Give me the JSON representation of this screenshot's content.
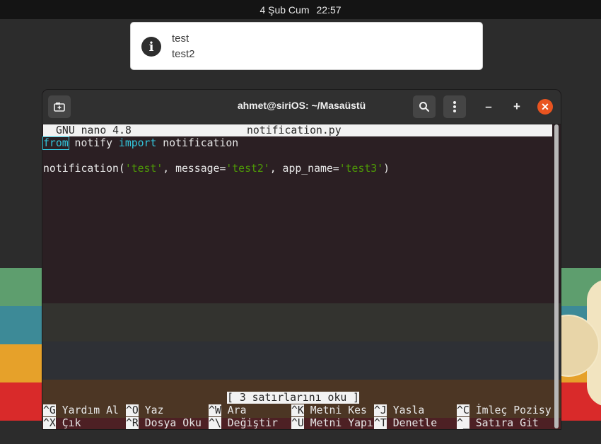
{
  "topbar": {
    "date": "4 Şub Cum",
    "time": "22:57"
  },
  "notification": {
    "icon": "info-icon",
    "title": "test",
    "body": "test2"
  },
  "terminal": {
    "title": "ahmet@siriOS: ~/Masaüstü",
    "buttons": {
      "new_tab": "new-tab-icon",
      "search": "search-icon",
      "menu": "menu-icon",
      "minimize": "–",
      "maximize": "+",
      "close": "✕"
    },
    "nano": {
      "version": "GNU nano 4.8",
      "filename": "notification.py",
      "code": {
        "line1": {
          "kw_from": "from",
          "module": " notify ",
          "kw_import": "import",
          "name": " notification"
        },
        "line3": {
          "call_open": "notification(",
          "arg1": "'test'",
          "mid1": ", message=",
          "arg2": "'test2'",
          "mid2": ", app_name=",
          "arg3": "'test3'",
          "close": ")"
        }
      },
      "status": "[ 3 satırlarını oku ]",
      "shortcuts": [
        {
          "key": "^G",
          "label": "Yardım Al"
        },
        {
          "key": "^O",
          "label": "Yaz"
        },
        {
          "key": "^W",
          "label": "Ara"
        },
        {
          "key": "^K",
          "label": "Metni Kes"
        },
        {
          "key": "^J",
          "label": "Yasla"
        },
        {
          "key": "^C",
          "label": "İmleç Pozisy"
        },
        {
          "key": "^X",
          "label": "Çık"
        },
        {
          "key": "^R",
          "label": "Dosya Oku"
        },
        {
          "key": "^\\",
          "label": "Değiştir"
        },
        {
          "key": "^U",
          "label": "Metni Yapı"
        },
        {
          "key": "^T",
          "label": "Denetle"
        },
        {
          "key": "^_",
          "label": "Satıra Git"
        }
      ]
    }
  },
  "colors": {
    "accent_close": "#e95420",
    "syntax_keyword": "#33c7de",
    "syntax_string": "#4e9a06",
    "wallpaper_green": "#5e9e6e",
    "wallpaper_teal": "#3d8a97",
    "wallpaper_orange": "#e6a12a",
    "wallpaper_red": "#d92a2a"
  }
}
